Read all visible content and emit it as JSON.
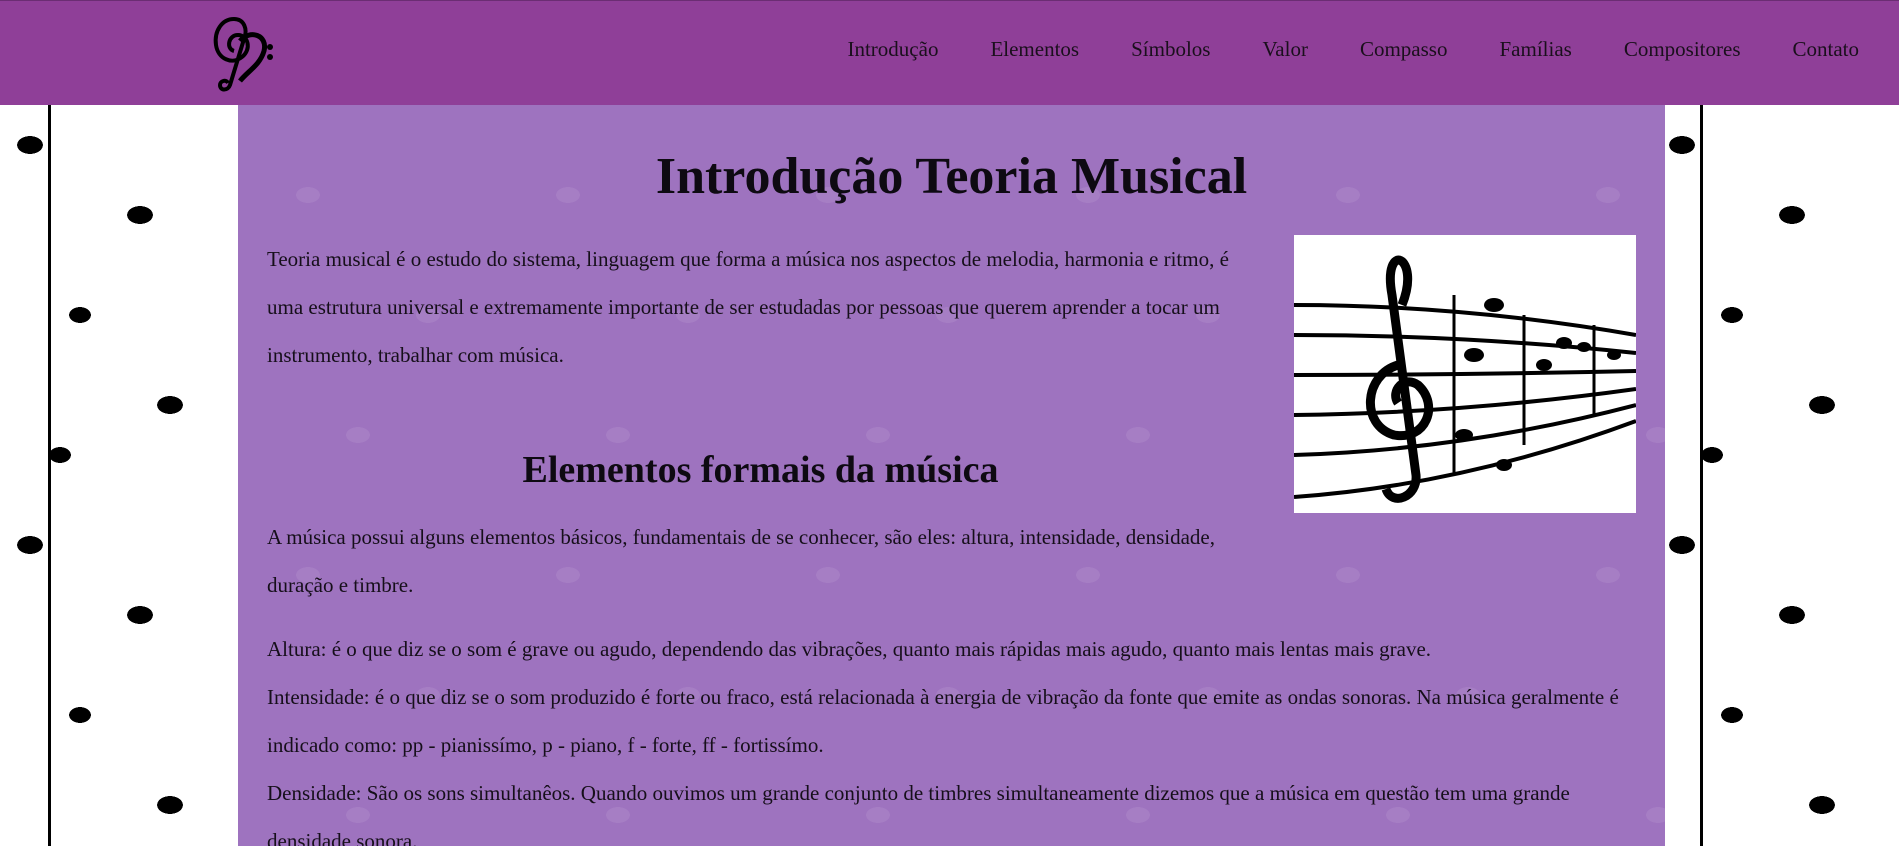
{
  "header": {
    "logo_icon": "treble-bass-clef-heart-icon",
    "background_color": "#8f3f98",
    "nav": [
      {
        "label": "Introdução"
      },
      {
        "label": "Elementos"
      },
      {
        "label": "Símbolos"
      },
      {
        "label": "Valor"
      },
      {
        "label": "Compasso"
      },
      {
        "label": "Famílias"
      },
      {
        "label": "Compositores"
      },
      {
        "label": "Contato"
      }
    ]
  },
  "main": {
    "background_color": "#9e73bf",
    "title": "Introdução Teoria Musical",
    "intro": "Teoria musical é o estudo do sistema, linguagem que forma a música nos aspectos de melodia, harmonia e ritmo, é uma estrutura universal e extremamente importante de ser estudadas por pessoas que querem aprender a tocar um instrumento, trabalhar com música.",
    "image_icon": "music-staff-treble-clef-image",
    "section_title": "Elementos formais da música",
    "section_intro": "A música possui alguns elementos básicos, fundamentais de se conhecer, são eles: altura, intensidade, densidade, duração e timbre.",
    "details": [
      "Altura: é o que diz se o som é grave ou agudo, dependendo das vibrações, quanto mais rápidas mais agudo, quanto mais lentas mais grave.",
      "Intensidade: é o que diz se o som produzido é forte ou fraco, está relacionada à energia de vibração da fonte que emite as ondas sonoras. Na música geralmente é indicado como: pp - pianissímo, p - piano, f - forte, ff - fortissímo.",
      "Densidade: São os sons simultanêos. Quando ouvimos um grande conjunto de timbres simultaneamente dizemos que a música em questão tem uma grande densidade sonora."
    ]
  },
  "background": {
    "pattern_icon": "music-notes-pattern"
  }
}
